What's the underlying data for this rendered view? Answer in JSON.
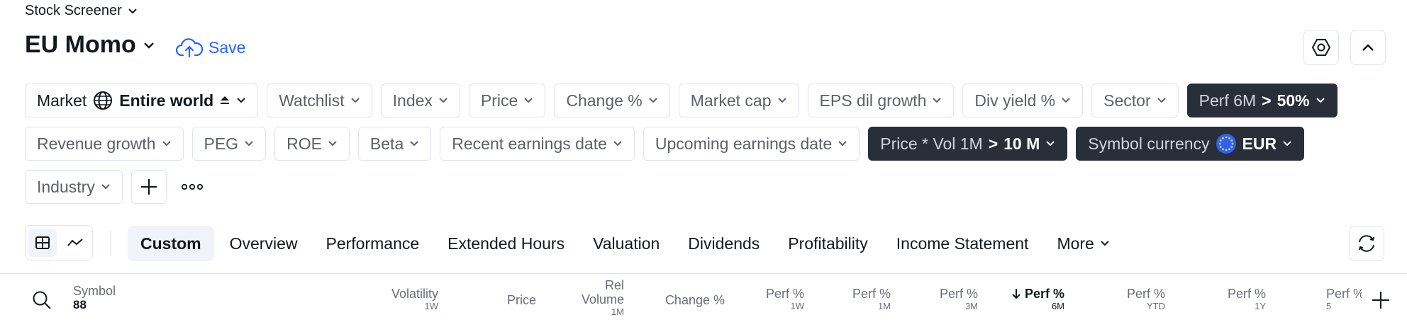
{
  "header": {
    "breadcrumb": "Stock Screener",
    "screen_name": "EU Momo",
    "save_label": "Save"
  },
  "filters": [
    {
      "label": "Market",
      "value": "Entire world",
      "active": false
    },
    {
      "label": "Watchlist"
    },
    {
      "label": "Index"
    },
    {
      "label": "Price"
    },
    {
      "label": "Change %"
    },
    {
      "label": "Market cap"
    },
    {
      "label": "EPS dil growth"
    },
    {
      "label": "Div yield %"
    },
    {
      "label": "Sector"
    },
    {
      "label": "Perf 6M",
      "operator": ">",
      "value": "50%",
      "active": true
    },
    {
      "label": "Revenue growth"
    },
    {
      "label": "PEG"
    },
    {
      "label": "ROE"
    },
    {
      "label": "Beta"
    },
    {
      "label": "Recent earnings date"
    },
    {
      "label": "Upcoming earnings date"
    },
    {
      "label": "Price * Vol 1M",
      "operator": ">",
      "value": "10 M",
      "active": true
    },
    {
      "label": "Symbol currency",
      "value": "EUR",
      "active": true
    },
    {
      "label": "Industry"
    }
  ],
  "tabs": [
    {
      "label": "Custom",
      "active": true
    },
    {
      "label": "Overview"
    },
    {
      "label": "Performance"
    },
    {
      "label": "Extended Hours"
    },
    {
      "label": "Valuation"
    },
    {
      "label": "Dividends"
    },
    {
      "label": "Profitability"
    },
    {
      "label": "Income Statement"
    },
    {
      "label": "More"
    }
  ],
  "table": {
    "symbol_header": "Symbol",
    "symbol_count": "88",
    "columns": [
      {
        "label": "Volatility",
        "sub": "1W"
      },
      {
        "label": "Price",
        "sub": ""
      },
      {
        "label": "Rel Volume",
        "sub": "1M",
        "line1": "Rel",
        "line2": "Volume"
      },
      {
        "label": "Change %",
        "sub": ""
      },
      {
        "label": "Perf %",
        "sub": "1W"
      },
      {
        "label": "Perf %",
        "sub": "1M"
      },
      {
        "label": "Perf %",
        "sub": "3M"
      },
      {
        "label": "Perf %",
        "sub": "6M",
        "sorted": "desc"
      },
      {
        "label": "Perf %",
        "sub": "YTD"
      },
      {
        "label": "Perf %",
        "sub": "1Y"
      },
      {
        "label": "Perf %",
        "sub": "5"
      }
    ]
  },
  "colors": {
    "accent": "#2962ff",
    "dark_pill": "#2a2e39",
    "border": "#e0e3eb"
  }
}
